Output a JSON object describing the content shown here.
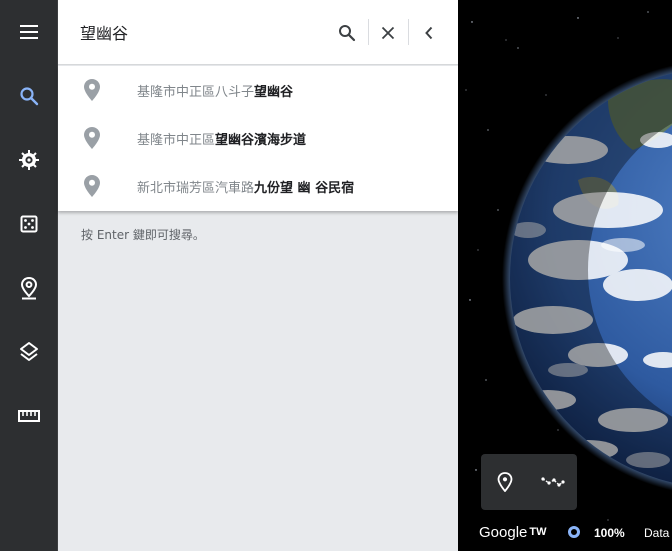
{
  "sidebar": {
    "items": [
      {
        "name": "menu-icon"
      },
      {
        "name": "search-icon",
        "active": true
      },
      {
        "name": "voyager-icon"
      },
      {
        "name": "feeling-lucky-icon"
      },
      {
        "name": "projects-icon"
      },
      {
        "name": "map-style-icon"
      },
      {
        "name": "measure-icon"
      }
    ],
    "accent": "#8ab4f8"
  },
  "search": {
    "value": "望幽谷"
  },
  "suggestions": [
    {
      "prefix": "基隆市中正區八斗子",
      "highlight": "望幽谷"
    },
    {
      "prefix": "基隆市中正區",
      "highlight": "望幽谷濱海步道"
    },
    {
      "prefix": "新北市瑞芳區汽車路",
      "highlight": "九份望 幽 谷民宿"
    }
  ],
  "hint": "按 Enter 鍵即可搜尋。",
  "footer": {
    "brand": "Google",
    "brand_region": "TW",
    "zoom": "100%",
    "attribution": "Data"
  }
}
